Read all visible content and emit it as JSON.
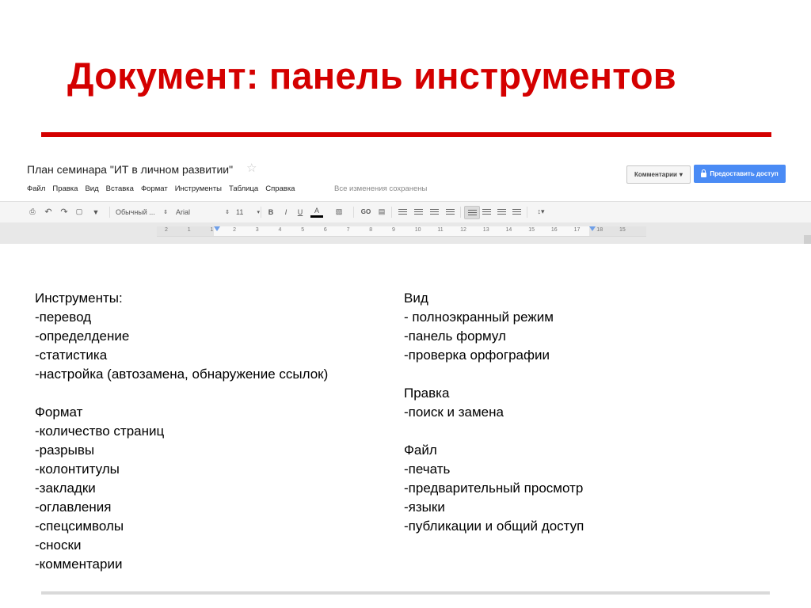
{
  "slide": {
    "title": "Документ: панель инструментов"
  },
  "screenshot": {
    "doc_title": "План семинара \"ИТ в личном развитии\"",
    "menu": [
      "Файл",
      "Правка",
      "Вид",
      "Вставка",
      "Формат",
      "Инструменты",
      "Таблица",
      "Справка"
    ],
    "saved_status": "Все изменения сохранены",
    "comments_label": "Комментарии",
    "share_label": "Предоставить доступ",
    "style_value": "Обычный ...",
    "font_value": "Arial",
    "size_value": "11",
    "bold": "B",
    "italic": "I",
    "underline": "U",
    "text_color": "A",
    "link": "GO",
    "ruler_ticks": [
      "2",
      "1",
      "1",
      "2",
      "3",
      "4",
      "5",
      "6",
      "7",
      "8",
      "9",
      "10",
      "11",
      "12",
      "13",
      "14",
      "15",
      "16",
      "17",
      "18",
      "15"
    ]
  },
  "left_column": {
    "sections": [
      {
        "heading": "Инструменты:",
        "items": [
          "-перевод",
          "-определдение",
          "-статистика",
          "-настройка (автозамена, обнаружение ссылок)"
        ]
      },
      {
        "heading": "Формат",
        "items": [
          "-количество страниц",
          "-разрывы",
          "-колонтитулы",
          "-закладки",
          "-оглавления",
          "-спецсимволы",
          "-сноски",
          "-комментарии"
        ]
      }
    ]
  },
  "right_column": {
    "sections": [
      {
        "heading": "Вид",
        "items": [
          "- полноэкранный режим",
          "-панель формул",
          "-проверка орфографии"
        ]
      },
      {
        "heading": "Правка",
        "items": [
          "-поиск и замена"
        ]
      },
      {
        "heading": "Файл",
        "items": [
          "-печать",
          "-предварительный просмотр",
          "-языки",
          "-публикации и общий доступ"
        ]
      }
    ]
  },
  "colors": {
    "title_red": "#d40000",
    "share_blue": "#4a8bf5"
  }
}
